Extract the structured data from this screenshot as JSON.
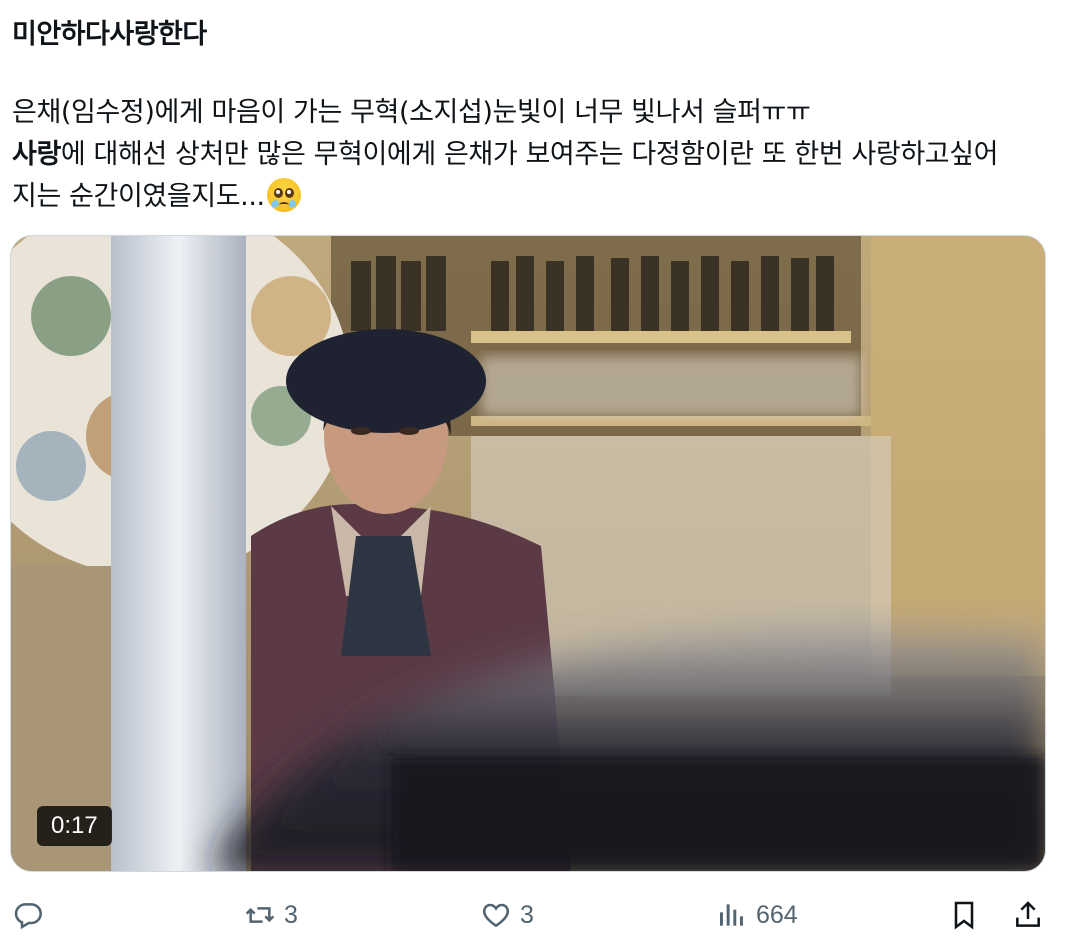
{
  "post": {
    "title": "미안하다사랑한다",
    "line1": "은채(임수정)에게 마음이 가는 무혁(소지섭)눈빛이 너무 빛나서 슬퍼ㅠㅠ",
    "line2_bold": "사랑",
    "line2_rest": "에 대해선 상처만 많은 무혁이에게 은채가 보여주는 다정함이란 또 한번 사랑하고싶어",
    "line3": "지는 순간이였을지도...",
    "emoji": "crying-face-emoji"
  },
  "video": {
    "duration": "0:17"
  },
  "actions": {
    "reply_count": "",
    "repost_count": "3",
    "like_count": "3",
    "view_count": "664"
  },
  "icons": {
    "reply": "reply-icon",
    "repost": "repost-icon",
    "like": "heart-icon",
    "views": "views-icon",
    "bookmark": "bookmark-icon",
    "share": "share-icon"
  },
  "colors": {
    "text": "#0f1419",
    "secondary": "#536471",
    "border": "#cfd9de"
  }
}
